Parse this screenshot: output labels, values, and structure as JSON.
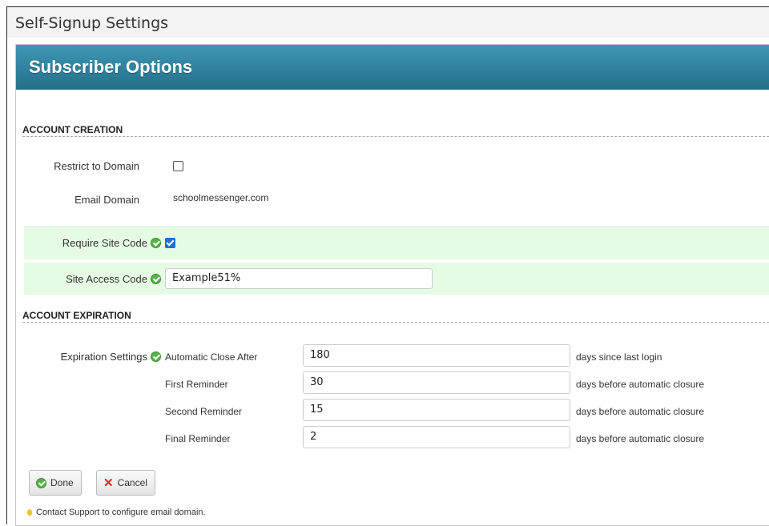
{
  "window": {
    "title": "Self-Signup Settings"
  },
  "panel": {
    "title": "Subscriber Options"
  },
  "account_creation": {
    "heading": "ACCOUNT CREATION",
    "restrict_to_domain": {
      "label": "Restrict to Domain",
      "checked": false
    },
    "email_domain": {
      "label": "Email Domain",
      "value": "schoolmessenger.com"
    },
    "require_site_code": {
      "label": "Require Site Code",
      "checked": true,
      "icon": "check-circle-icon"
    },
    "site_access_code": {
      "label": "Site Access Code",
      "value": "Example51%",
      "icon": "check-circle-icon"
    }
  },
  "account_expiration": {
    "heading": "ACCOUNT EXPIRATION",
    "label": "Expiration Settings",
    "rows": [
      {
        "name": "Automatic Close After",
        "value": "180",
        "suffix": "days since last login"
      },
      {
        "name": "First Reminder",
        "value": "30",
        "suffix": "days before automatic closure"
      },
      {
        "name": "Second Reminder",
        "value": "15",
        "suffix": "days before automatic closure"
      },
      {
        "name": "Final Reminder",
        "value": "2",
        "suffix": "days before automatic closure"
      }
    ]
  },
  "buttons": {
    "done": "Done",
    "cancel": "Cancel"
  },
  "tip": "Contact Support to configure email domain.",
  "colors": {
    "header": "#2a7f9c",
    "highlight": "#e6fbe3",
    "check_green": "#58b24a",
    "cancel_red": "#d62b2b"
  }
}
